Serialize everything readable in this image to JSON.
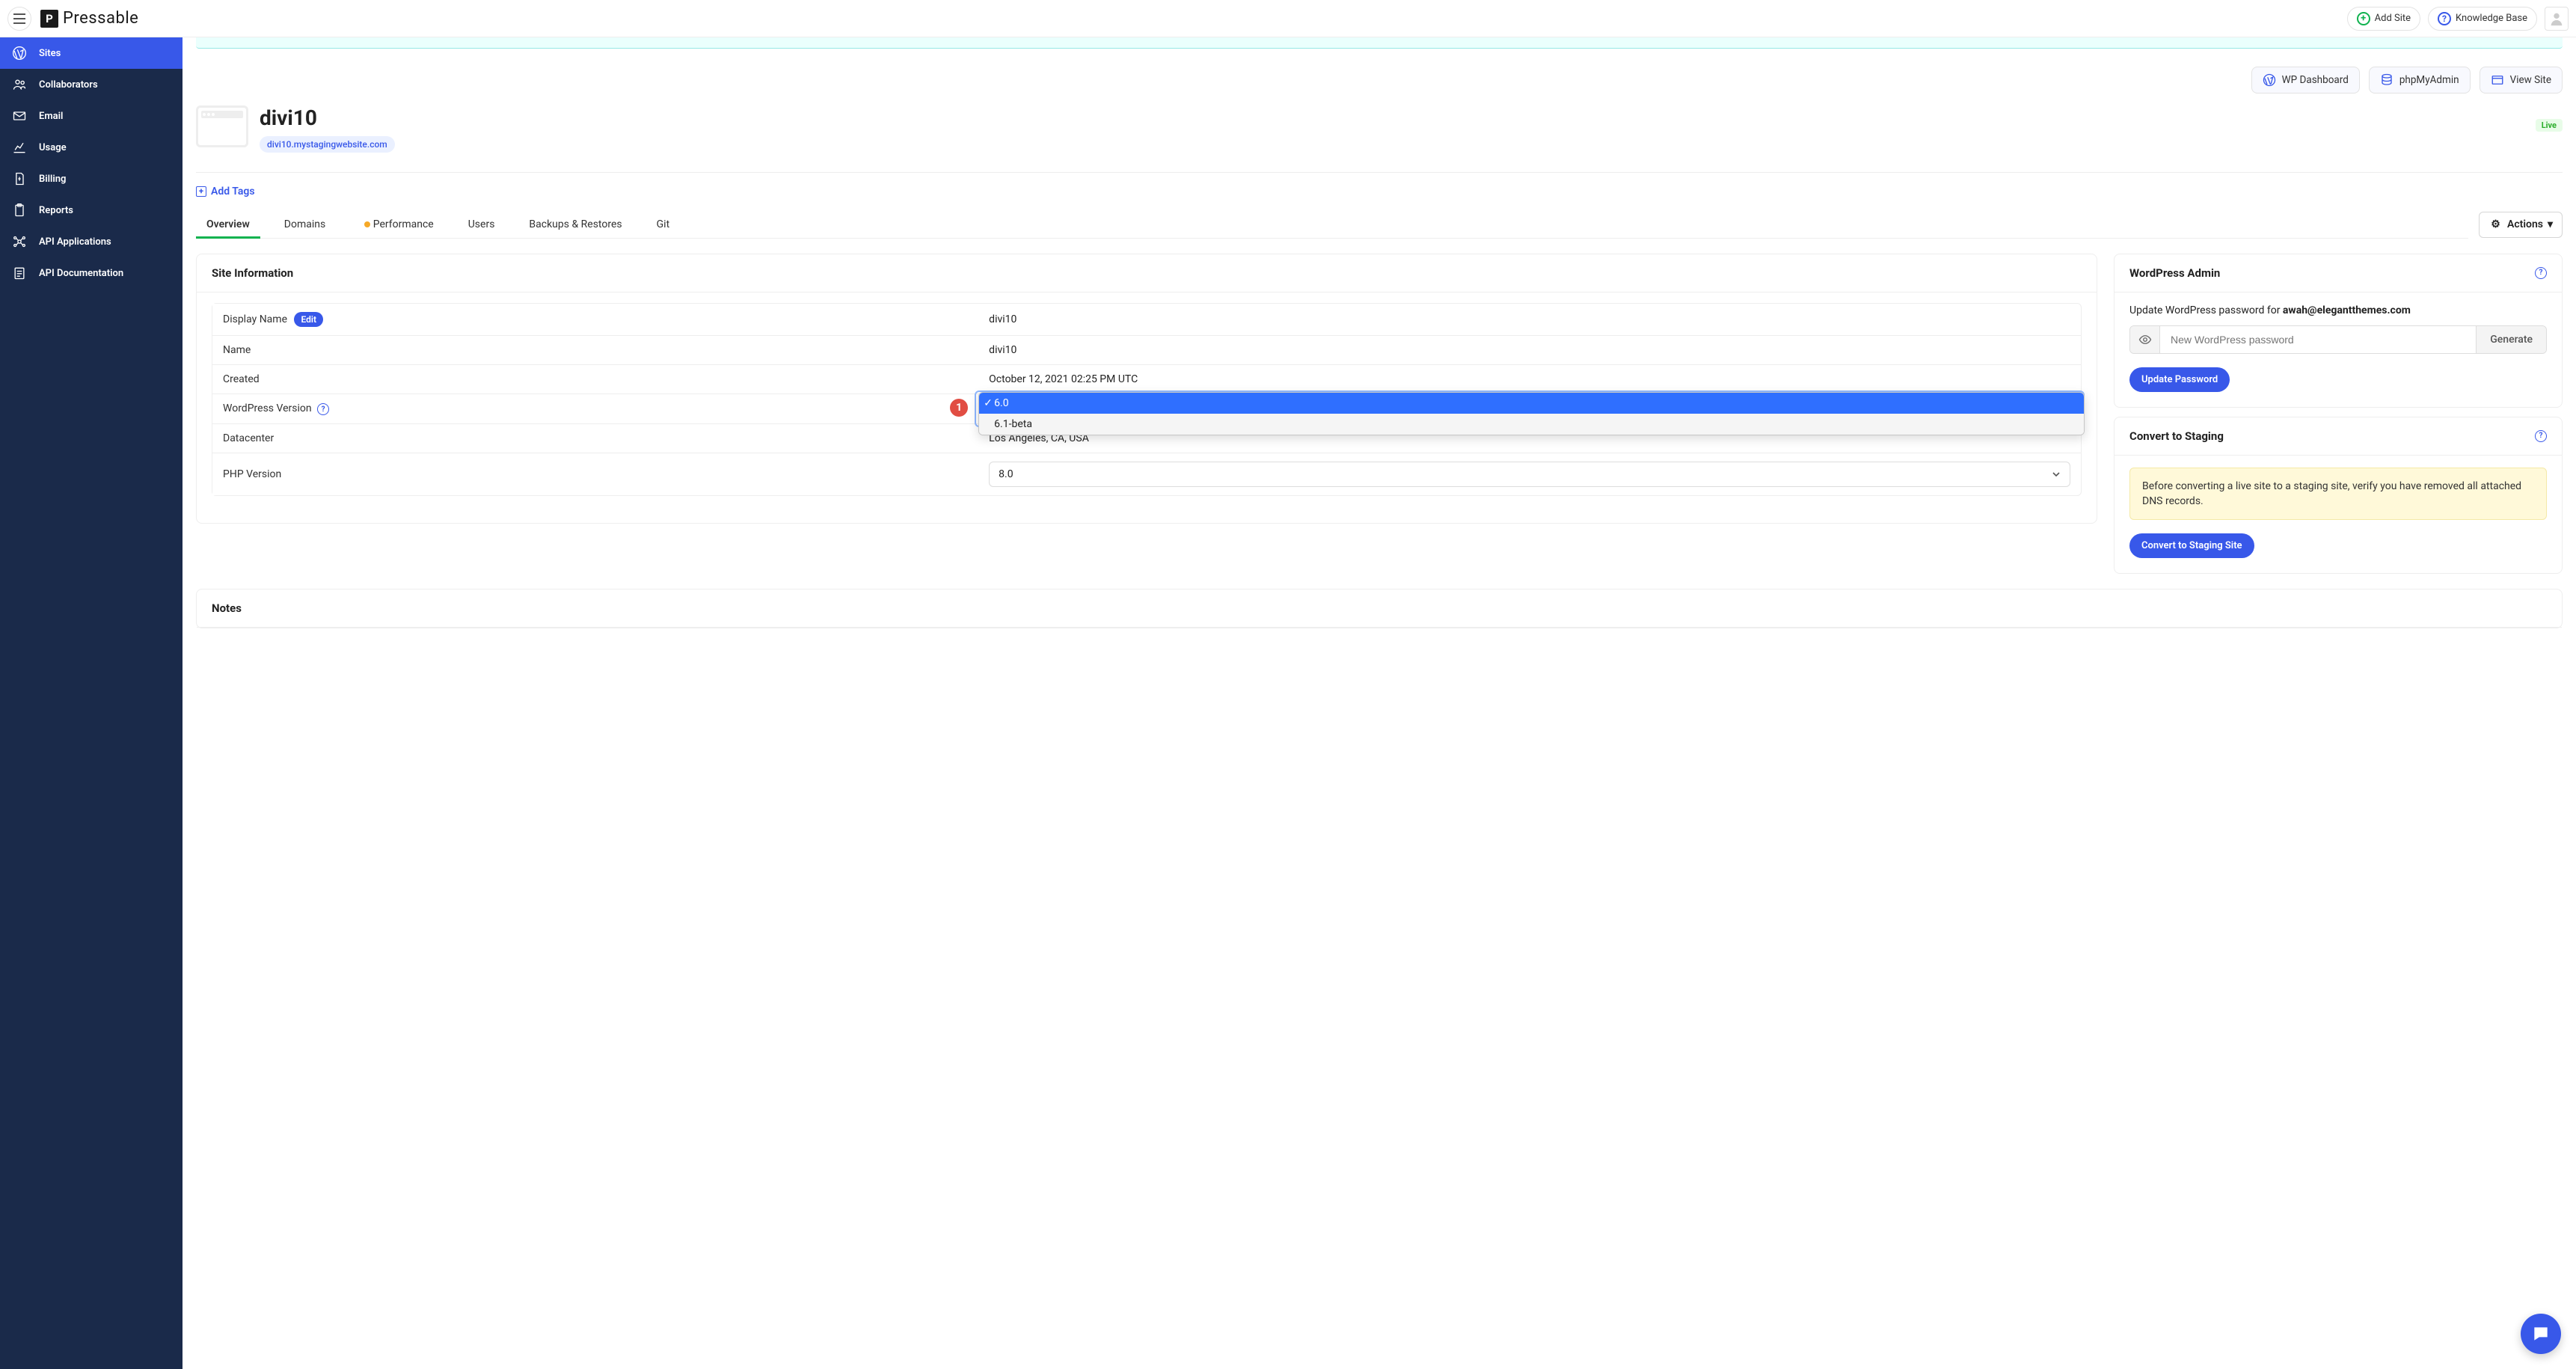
{
  "header": {
    "brand": "Pressable",
    "add_site_label": "Add Site",
    "knowledge_base_label": "Knowledge Base"
  },
  "sidebar": {
    "items": [
      {
        "label": "Sites",
        "icon": "wordpress-icon",
        "active": true
      },
      {
        "label": "Collaborators",
        "icon": "users-icon"
      },
      {
        "label": "Email",
        "icon": "mail-icon"
      },
      {
        "label": "Usage",
        "icon": "chart-icon"
      },
      {
        "label": "Billing",
        "icon": "file-icon"
      },
      {
        "label": "Reports",
        "icon": "clipboard-icon"
      },
      {
        "label": "API Applications",
        "icon": "api-icon"
      },
      {
        "label": "API Documentation",
        "icon": "doc-icon"
      }
    ]
  },
  "site_actions": {
    "wp_dashboard_label": "WP Dashboard",
    "phpmyadmin_label": "phpMyAdmin",
    "view_site_label": "View Site"
  },
  "site_header": {
    "title": "divi10",
    "domain": "divi10.mystagingwebsite.com",
    "status_label": "Live",
    "add_tags_label": "Add Tags"
  },
  "tabs": {
    "items": [
      "Overview",
      "Domains",
      "Performance",
      "Users",
      "Backups & Restores",
      "Git"
    ],
    "performance_has_status": true,
    "actions_label": "Actions"
  },
  "site_info": {
    "panel_title": "Site Information",
    "display_name_label": "Display Name",
    "edit_label": "Edit",
    "display_name_value": "divi10",
    "name_label": "Name",
    "name_value": "divi10",
    "created_label": "Created",
    "created_value": "October 12, 2021 02:25 PM UTC",
    "wp_version_label": "WordPress Version",
    "wp_version_options": [
      "6.0",
      "6.1-beta"
    ],
    "wp_version_selected": "6.0",
    "annotation_number": "1",
    "datacenter_label": "Datacenter",
    "datacenter_value": "Los Angeles, CA, USA",
    "php_version_label": "PHP Version",
    "php_version_value": "8.0"
  },
  "wp_admin": {
    "panel_title": "WordPress Admin",
    "pw_prefix": "Update WordPress password for ",
    "pw_email": "awah@elegantthemes.com",
    "pw_placeholder": "New WordPress password",
    "generate_label": "Generate",
    "update_button_label": "Update Password"
  },
  "staging": {
    "panel_title": "Convert to Staging",
    "warning_text": "Before converting a live site to a staging site, verify you have removed all attached DNS records.",
    "button_label": "Convert to Staging Site"
  },
  "notes": {
    "panel_title": "Notes"
  }
}
